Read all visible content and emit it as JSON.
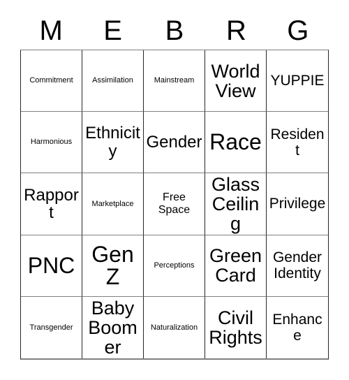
{
  "card": {
    "header_letters": [
      "M",
      "E",
      "B",
      "R",
      "G"
    ],
    "grid": {
      "rows": 5,
      "columns": 5,
      "border_color": "#262626",
      "grid_line_color": "#808080",
      "background_color": "#ffffff",
      "text_color": "#000000"
    },
    "cells": [
      {
        "text": "Commitment",
        "size": "fs-xs"
      },
      {
        "text": "Assimilation",
        "size": "fs-xs"
      },
      {
        "text": "Mainstream",
        "size": "fs-xs"
      },
      {
        "text": "World View",
        "size": "fs-xxl"
      },
      {
        "text": "YUPPIE",
        "size": "fs-lg"
      },
      {
        "text": "Harmonious",
        "size": "fs-xs"
      },
      {
        "text": "Ethnicity",
        "size": "fs-xl"
      },
      {
        "text": "Gender",
        "size": "fs-xl"
      },
      {
        "text": "Race",
        "size": "fs-huge"
      },
      {
        "text": "Resident",
        "size": "fs-lg"
      },
      {
        "text": "Rapport",
        "size": "fs-xl"
      },
      {
        "text": "Marketplace",
        "size": "fs-xs"
      },
      {
        "text": "Free Space",
        "size": "fs-md"
      },
      {
        "text": "Glass Ceiling",
        "size": "fs-xxl"
      },
      {
        "text": "Privilege",
        "size": "fs-lg"
      },
      {
        "text": "PNC",
        "size": "fs-huge"
      },
      {
        "text": "Gen Z",
        "size": "fs-huge"
      },
      {
        "text": "Perceptions",
        "size": "fs-xs"
      },
      {
        "text": "Green Card",
        "size": "fs-xxl"
      },
      {
        "text": "Gender Identity",
        "size": "fs-lg"
      },
      {
        "text": "Transgender",
        "size": "fs-xs"
      },
      {
        "text": "Baby Boomer",
        "size": "fs-xxl"
      },
      {
        "text": "Naturalization",
        "size": "fs-xs"
      },
      {
        "text": "Civil Rights",
        "size": "fs-xxl"
      },
      {
        "text": "Enhance",
        "size": "fs-lg"
      }
    ]
  }
}
